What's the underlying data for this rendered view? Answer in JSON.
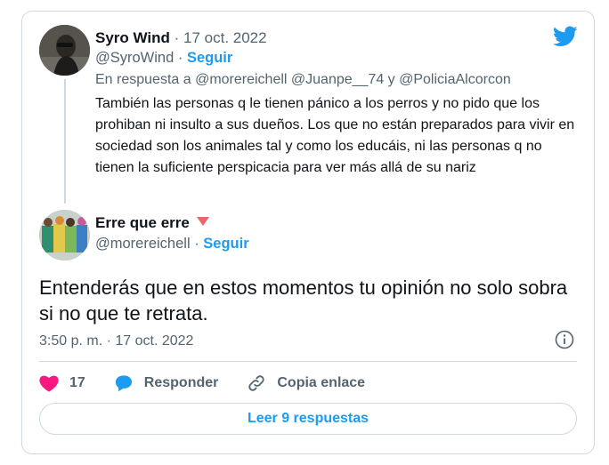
{
  "reply_tweet": {
    "author_name": "Syro Wind",
    "date": " · 17 oct. 2022",
    "handle": "@SyroWind",
    "follow": "Seguir",
    "reply_to": "En respuesta a @morereichell @Juanpe__74 y @PoliciaAlcorcon",
    "text": "También las personas q le tienen pánico a los perros y no pido que los prohiban ni insulto a sus dueños. Los que no están preparados para vivir en sociedad son los animales tal y como los educáis, ni las personas q no tienen la suficiente perspicacia para ver más allá de su nariz"
  },
  "main_tweet": {
    "author_name": "Erre que erre",
    "handle": "@morereichell",
    "follow": "Seguir",
    "text": "Entenderás que en estos momentos tu opinión no solo sobra si no que te retrata.",
    "timestamp": "3:50 p. m. · 17 oct. 2022"
  },
  "actions": {
    "likes": "17",
    "reply_label": "Responder",
    "copy_label": "Copia enlace"
  },
  "read_replies_label": "Leer 9 respuestas",
  "icons": [
    "twitter-bird-icon",
    "heart-icon",
    "reply-bubble-icon",
    "link-icon",
    "info-icon",
    "red-triangle-icon"
  ],
  "colors": {
    "accent": "#1d9bf0",
    "heart": "#f91880",
    "muted": "#536471",
    "border": "#cfd9de"
  }
}
